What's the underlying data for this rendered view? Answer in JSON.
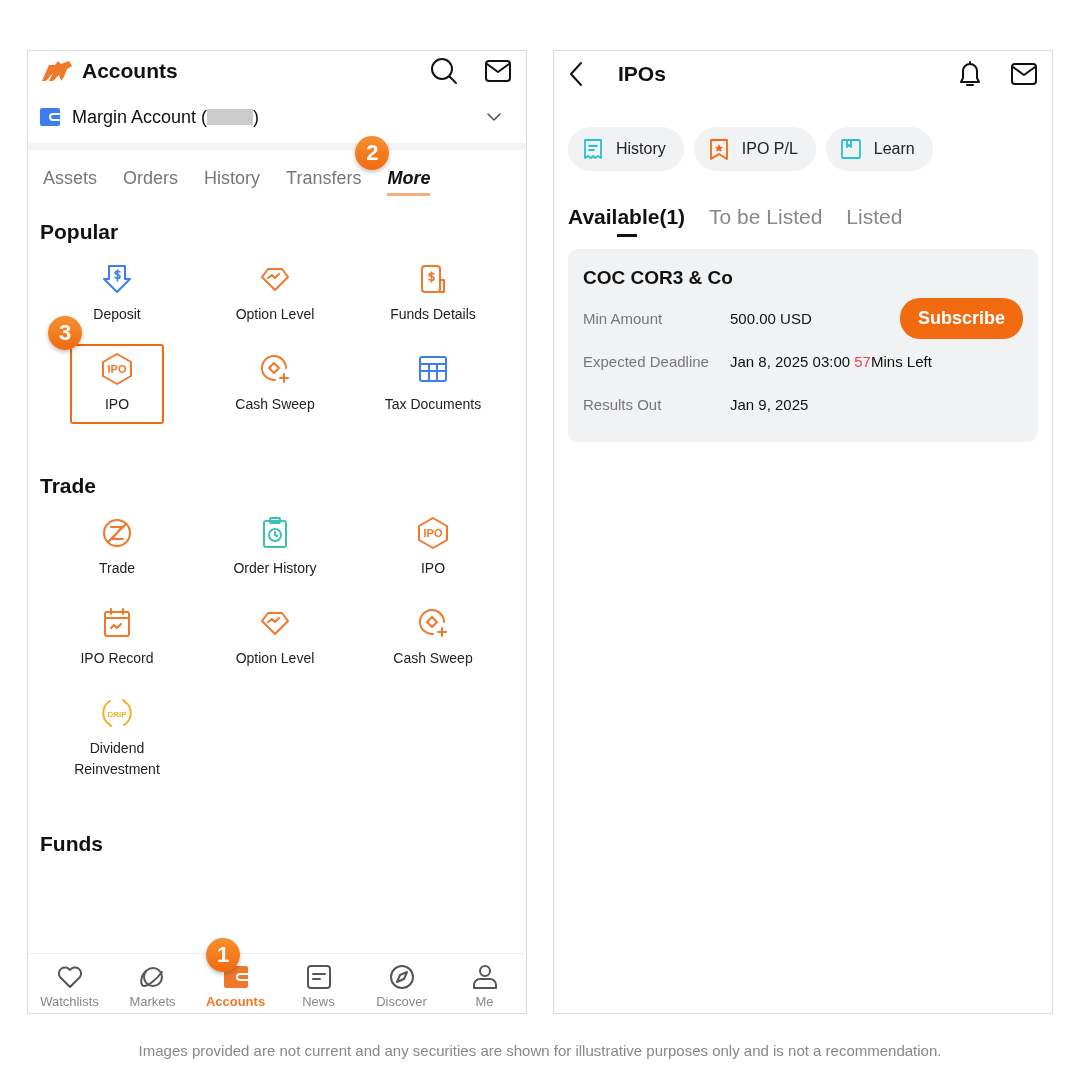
{
  "accounts_screen": {
    "title": "Accounts",
    "account_selector": {
      "label_start": "Margin Account (",
      "label_end": ")"
    },
    "tabs": [
      {
        "label": "Assets",
        "selected": false
      },
      {
        "label": "Orders",
        "selected": false
      },
      {
        "label": "History",
        "selected": false
      },
      {
        "label": "Transfers",
        "selected": false
      },
      {
        "label": "More",
        "selected": true,
        "callout": "2"
      }
    ],
    "sections": [
      {
        "title": "Popular",
        "items": [
          {
            "label": "Deposit",
            "kind": "deposit",
            "highlighted": false
          },
          {
            "label": "Option Level",
            "kind": "diamond",
            "highlighted": false
          },
          {
            "label": "Funds Details",
            "kind": "funds",
            "highlighted": false
          },
          {
            "label": "IPO",
            "kind": "ipo",
            "icon_text": "IPO",
            "highlighted": true,
            "callout": "3"
          },
          {
            "label": "Cash Sweep",
            "kind": "sweep",
            "highlighted": false
          },
          {
            "label": "Tax Documents",
            "kind": "table",
            "highlighted": false
          }
        ]
      },
      {
        "title": "Trade",
        "items": [
          {
            "label": "Trade",
            "kind": "trade",
            "highlighted": false
          },
          {
            "label": "Order History",
            "kind": "clipboard",
            "highlighted": false
          },
          {
            "label": "IPO",
            "kind": "ipo",
            "icon_text": "IPO",
            "highlighted": false
          },
          {
            "label": "IPO  Record",
            "kind": "calendar",
            "highlighted": false
          },
          {
            "label": "Option Level",
            "kind": "diamond",
            "highlighted": false
          },
          {
            "label": "Cash Sweep",
            "kind": "sweep",
            "highlighted": false
          },
          {
            "label": "Dividend Reinvestment",
            "kind": "drip",
            "icon_text": "DRIP",
            "highlighted": false
          }
        ]
      },
      {
        "title": "Funds"
      }
    ],
    "bottom_nav": [
      {
        "label": "Watchlists",
        "kind": "heart",
        "selected": false
      },
      {
        "label": "Markets",
        "kind": "planet",
        "selected": false
      },
      {
        "label": "Accounts",
        "kind": "wallet",
        "selected": true,
        "callout": "1"
      },
      {
        "label": "News",
        "kind": "news",
        "selected": false
      },
      {
        "label": "Discover",
        "kind": "compass",
        "selected": false
      },
      {
        "label": "Me",
        "kind": "person",
        "selected": false
      }
    ]
  },
  "ipo_screen": {
    "title": "IPOs",
    "shortcuts": [
      {
        "label": "History",
        "kind": "receipt"
      },
      {
        "label": "IPO P/L",
        "kind": "star"
      },
      {
        "label": "Learn",
        "kind": "book"
      }
    ],
    "tabs": [
      {
        "label": "Available(1)",
        "selected": true
      },
      {
        "label": "To be Listed",
        "selected": false
      },
      {
        "label": "Listed",
        "selected": false
      }
    ],
    "card": {
      "name": "COC COR3 & Co",
      "button": "Subscribe",
      "rows": [
        {
          "label": "Min Amount",
          "value": "500.00 USD"
        },
        {
          "label": "Expected Deadline",
          "value": "Jan 8, 2025 03:00 ",
          "countdown": "57",
          "countdown_suffix": "Mins Left"
        },
        {
          "label": "Results Out",
          "value": "Jan 9, 2025"
        }
      ]
    }
  },
  "disclaimer": "Images provided are not current and any securities are shown for illustrative purposes only and is not a recommendation."
}
